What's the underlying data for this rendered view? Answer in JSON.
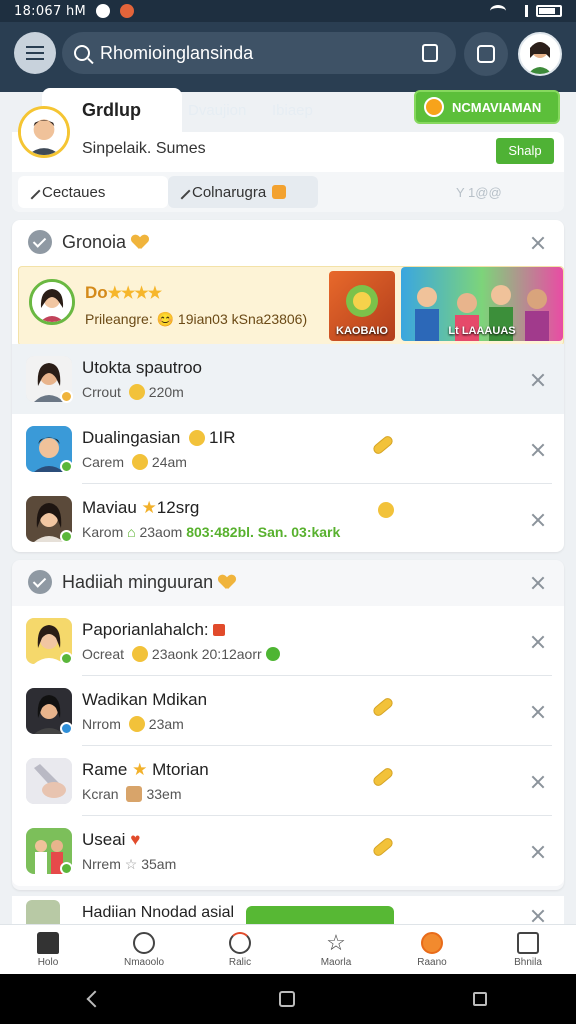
{
  "status_bar": {
    "time": "18:067 hM"
  },
  "header": {
    "search_text": "Rhomioinglansinda"
  },
  "group": {
    "tab_active": "Grdlup",
    "tabs": [
      "Dvaujion",
      "Ibiaep"
    ],
    "green_button": "NCMAVIAMAN",
    "subtitle": "Sinpelaik. Sumes",
    "share_label": "Shalp",
    "filters": [
      "Cectaues",
      "Colnarugra",
      "Y 1@@"
    ]
  },
  "section1": {
    "title": "Gronoia",
    "featured": {
      "title": "Do",
      "stars": "★★★★",
      "subtitle": "Prileangre: 😊 19ian03 kSna23806)",
      "image1_label": "KAOBAIO",
      "image2_label": "Lt LAAAUAS"
    },
    "rows": [
      {
        "name": "Utokta spautroo",
        "sub": "Crrout",
        "time": "220m"
      },
      {
        "name": "Dualingasian",
        "extra": "1IR",
        "sub": "Carem",
        "time": "24am"
      },
      {
        "name": "Maviau",
        "extra": "12srg",
        "sub": "Karom",
        "time": "23aom",
        "green": "803:482bl. San. 03:kark"
      }
    ]
  },
  "section2": {
    "title": "Hadiiah minguuran",
    "rows": [
      {
        "name": "Paporianlahalch:",
        "sub": "Ocreat",
        "time": "23aonk  20:12aorr"
      },
      {
        "name": "Wadikan Mdikan",
        "sub": "Nrrom",
        "time": "23am"
      },
      {
        "name": "Rame",
        "extra": "Mtorian",
        "sub": "Kcran",
        "time": "33em"
      },
      {
        "name": "Useai",
        "sub": "Nrrem",
        "time": "35am"
      }
    ],
    "partial_row": "Hadiian Nnodad asial"
  },
  "nav": [
    "Holo",
    "Nmaoolo",
    "Ralic",
    "Maorla",
    "Raano",
    "Bhnila"
  ],
  "colors": {
    "header": "#2a3e52",
    "accent_green": "#5cbf3a",
    "gold": "#f0b43c"
  }
}
